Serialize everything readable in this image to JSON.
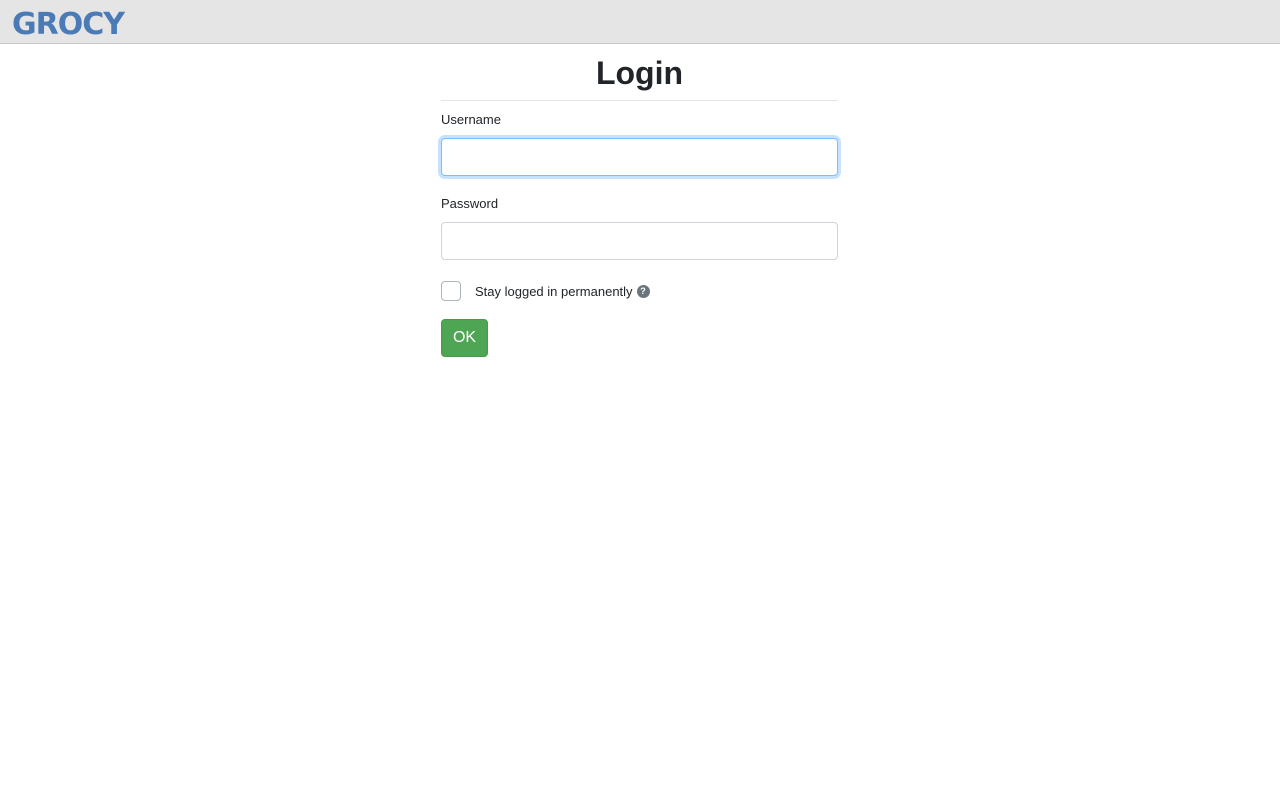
{
  "header": {
    "logo_text": "GROCY",
    "logo_color": "#4a7bb7",
    "background": "#e5e5e5"
  },
  "login": {
    "title": "Login",
    "username_label": "Username",
    "username_value": "",
    "password_label": "Password",
    "password_value": "",
    "stay_logged_in_label": "Stay logged in permanently",
    "stay_logged_in_checked": false,
    "help_icon": "question-circle-icon",
    "help_glyph": "?",
    "submit_label": "OK",
    "submit_color": "#4ea553"
  }
}
